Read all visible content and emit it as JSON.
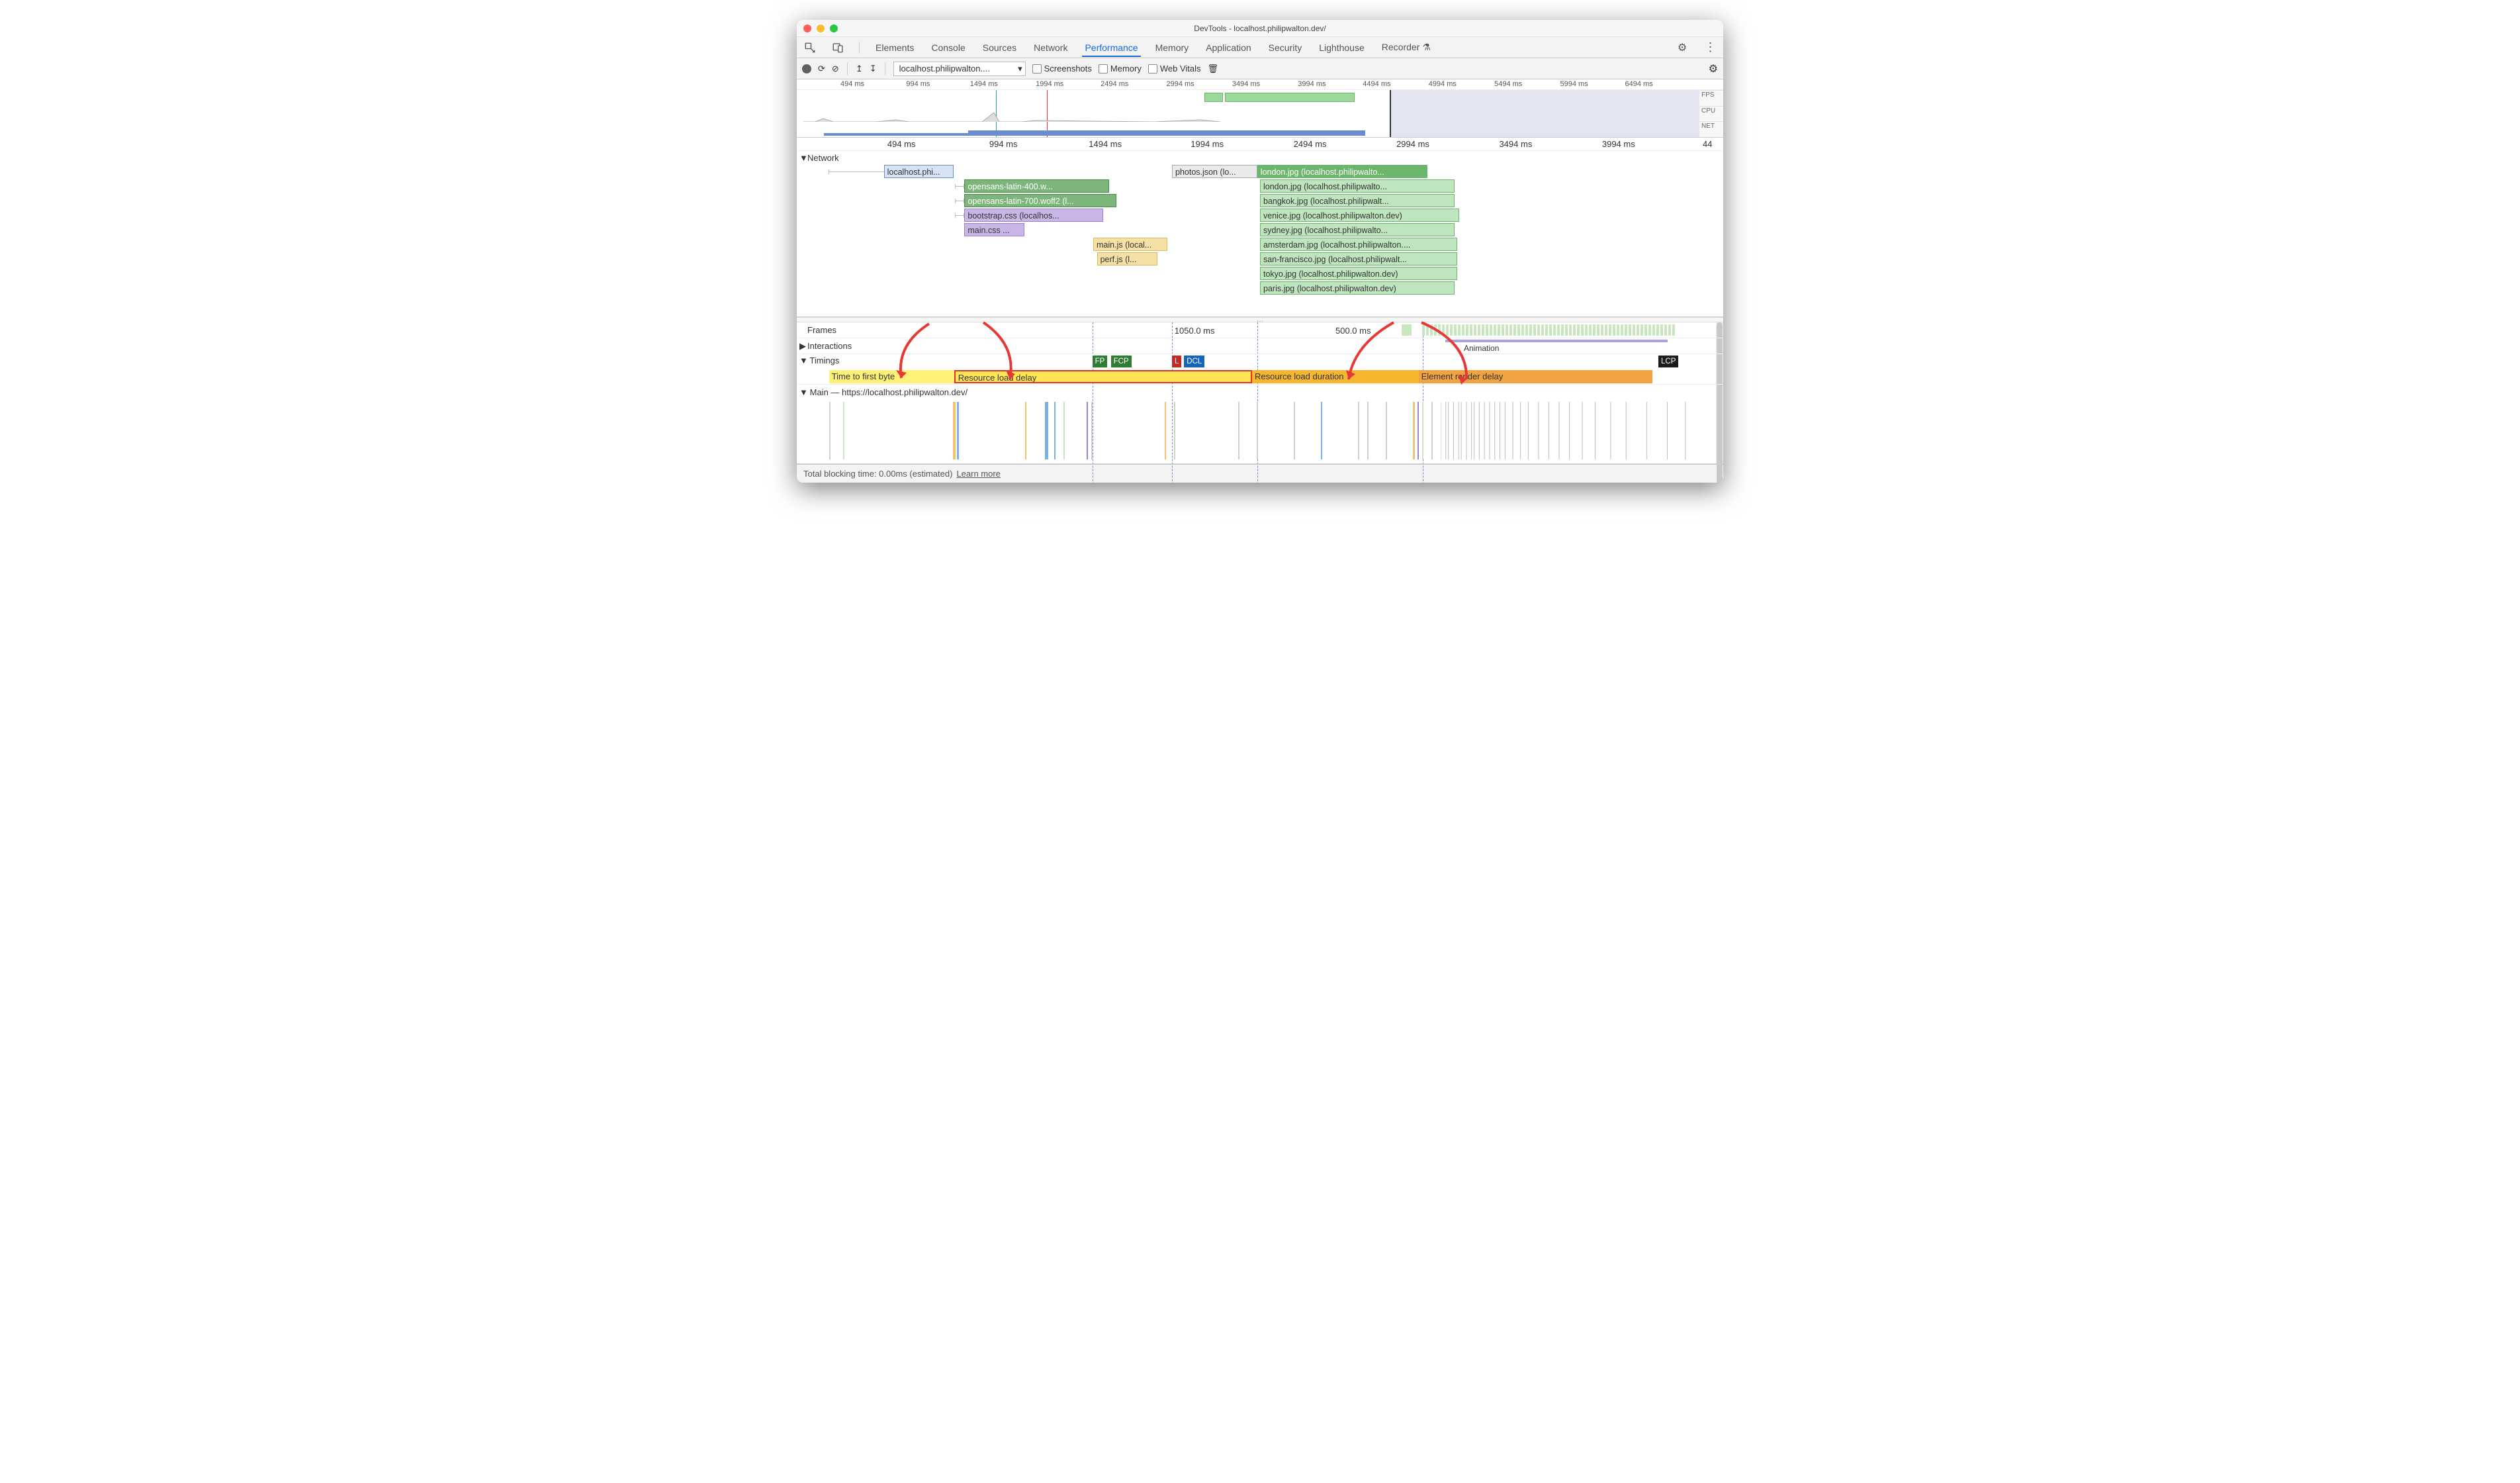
{
  "window": {
    "title": "DevTools - localhost.philipwalton.dev/"
  },
  "tabs": {
    "elements": "Elements",
    "console": "Console",
    "sources": "Sources",
    "network": "Network",
    "performance": "Performance",
    "memory": "Memory",
    "application": "Application",
    "security": "Security",
    "lighthouse": "Lighthouse",
    "recorder": "Recorder"
  },
  "toolbar": {
    "select_label": "localhost.philipwalton....",
    "screenshots": "Screenshots",
    "memory": "Memory",
    "web_vitals": "Web Vitals"
  },
  "overview_ticks": [
    "494 ms",
    "994 ms",
    "1494 ms",
    "1994 ms",
    "2494 ms",
    "2994 ms",
    "3494 ms",
    "3994 ms",
    "4494 ms",
    "4994 ms",
    "5494 ms",
    "5994 ms",
    "6494 ms"
  ],
  "overview_lanes": {
    "fps": "FPS",
    "cpu": "CPU",
    "net": "NET"
  },
  "main_ticks": [
    "494 ms",
    "994 ms",
    "1494 ms",
    "1994 ms",
    "2494 ms",
    "2994 ms",
    "3494 ms",
    "3994 ms",
    "44"
  ],
  "network_label": "Network",
  "requests": {
    "doc": "localhost.phi...",
    "font400": "opensans-latin-400.w...",
    "font700": "opensans-latin-700.woff2 (l...",
    "bootstrap": "bootstrap.css (localhos...",
    "maincss": "main.css ...",
    "mainjs": "main.js (local...",
    "perfjs": "perf.js (l...",
    "photos": "photos.json (lo...",
    "london1": "london.jpg (localhost.philipwalto...",
    "london2": "london.jpg (localhost.philipwalto...",
    "bangkok": "bangkok.jpg (localhost.philipwalt...",
    "venice": "venice.jpg (localhost.philipwalton.dev)",
    "sydney": "sydney.jpg (localhost.philipwalto...",
    "amsterdam": "amsterdam.jpg (localhost.philipwalton....",
    "sanfran": "san-francisco.jpg (localhost.philipwalt...",
    "tokyo": "tokyo.jpg (localhost.philipwalton.dev)",
    "paris": "paris.jpg (localhost.philipwalton.dev)"
  },
  "frames": {
    "label": "Frames",
    "ms_a": "1050.0 ms",
    "ms_b": "500.0 ms"
  },
  "interactions_label": "Interactions",
  "animation_label": "Animation",
  "timings": {
    "label": "Timings",
    "fp": "FP",
    "fcp": "FCP",
    "l": "L",
    "dcl": "DCL",
    "lcp": "LCP"
  },
  "phases": {
    "ttfb": "Time to first byte",
    "delay": "Resource load delay",
    "duration": "Resource load duration",
    "render": "Element render delay"
  },
  "main": {
    "label": "Main — https://localhost.philipwalton.dev/"
  },
  "footer": {
    "text": "Total blocking time: 0.00ms (estimated)",
    "link": "Learn more"
  }
}
